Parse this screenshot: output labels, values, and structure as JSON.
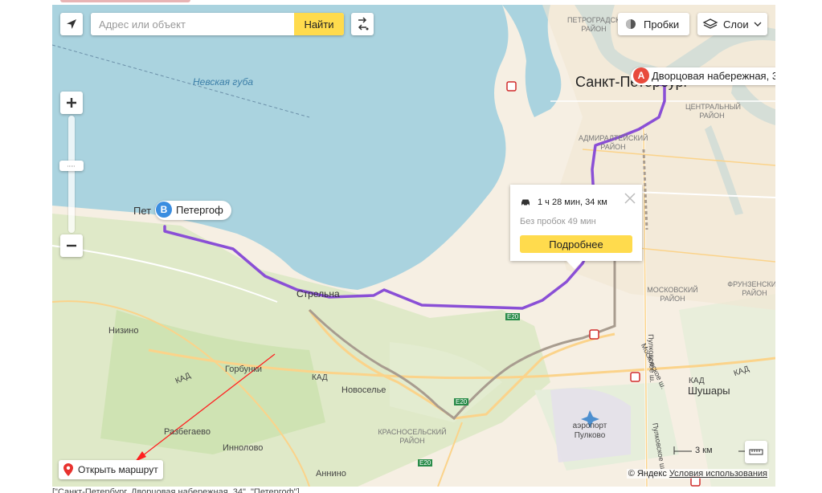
{
  "search": {
    "placeholder": "Адрес или объект",
    "button": "Найти"
  },
  "controls": {
    "traffic": "Пробки",
    "layers": "Слои",
    "open_route": "Открыть маршрут"
  },
  "route": {
    "from_letter": "A",
    "from_label": "Дворцовая набережная, 3",
    "to_letter": "B",
    "to_label": "Петергоф",
    "duration": "1 ч 28 мин, 34 км",
    "no_traffic": "Без пробок 49 мин",
    "details_button": "Подробнее"
  },
  "scale": {
    "label": "3 км"
  },
  "copyright": {
    "brand": "© Яндекс",
    "terms": "Условия использования"
  },
  "map_labels": {
    "bay": "Невская губа",
    "spb": "Санкт-Петербург",
    "petrogradsky": "ПЕТРОГРАДСКИЙ РАЙОН",
    "central": "ЦЕНТРАЛЬНЫЙ РАЙОН",
    "admiralteysky": "АДМИРАЛТЕЙСКИЙ РАЙОН",
    "moskovsky": "МОСКОВСКИЙ РАЙОН",
    "frunzensky": "ФРУНЗЕНСКИЙ РАЙОН",
    "krasnoselsky": "КРАСНОСЕЛЬСКИЙ РАЙОН",
    "petergof_map": "Пет",
    "strelna": "Стрельна",
    "nizino": "Низино",
    "gorbunki": "Горбунки",
    "novoselye": "Новоселье",
    "razbegaevo": "Разбегаево",
    "innolovo": "Иннолово",
    "annino": "Аннино",
    "shushary": "Шушары",
    "airport": "аэропорт Пулково",
    "kad1": "КАД",
    "kad2": "КАД",
    "kad3": "КАД",
    "kad4": "КАД",
    "e20a": "E20",
    "e20b": "E20",
    "e20c": "E20",
    "pulkovskoe": "Пулковское ш.",
    "moskovskoe": "Московское ш.",
    "pulkovskoe2": "Пулковское ш."
  },
  "footer_text": "[\"Санкт-Петербург, Дворцовая набережная, 34\", \"Петергоф\"]",
  "colors": {
    "route": "#8a4fd6",
    "accent": "#ffdb4d",
    "water": "#aad3df",
    "pinA": "#e84a3c",
    "pinB": "#3a8de0"
  }
}
